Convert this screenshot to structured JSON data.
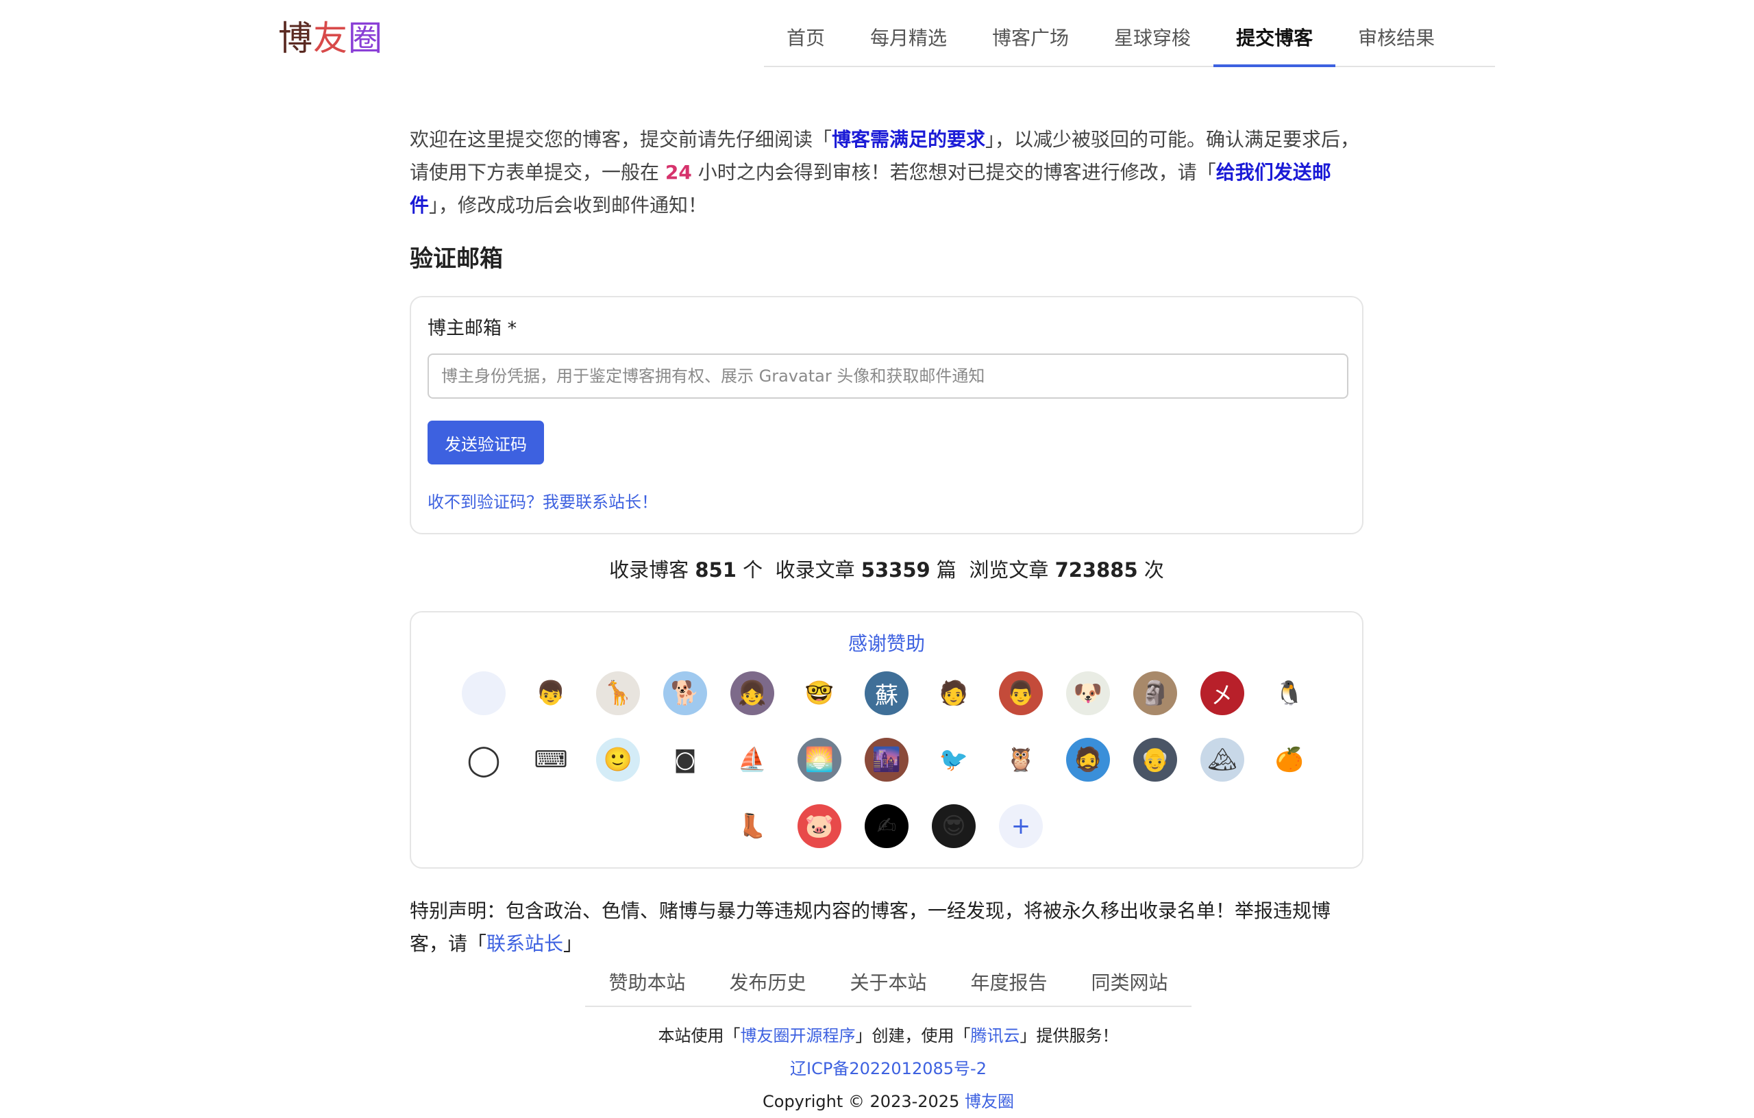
{
  "site": {
    "logo_chars": [
      "博",
      "友",
      "圈"
    ],
    "logo_colors": [
      "#5b2a22",
      "#d84a4a",
      "#8a3fd6"
    ]
  },
  "nav": {
    "items": [
      {
        "label": "首页"
      },
      {
        "label": "每月精选"
      },
      {
        "label": "博客广场"
      },
      {
        "label": "星球穿梭"
      },
      {
        "label": "提交博客",
        "active": true
      },
      {
        "label": "审核结果"
      }
    ]
  },
  "intro": {
    "t1": "欢迎在这里提交您的博客，提交前请先仔细阅读「",
    "link_requirements": "博客需满足的要求",
    "t2": "」，以减少被驳回的可能。确认满足要求后，请使用下方表单提交，一般在 ",
    "hours": "24",
    "t3": " 小时之内会得到审核！若您想对已提交的博客进行修改，请「",
    "link_email": "给我们发送邮件",
    "t4": "」，修改成功后会收到邮件通知！"
  },
  "verify": {
    "heading": "验证邮箱",
    "field_label": "博主邮箱 *",
    "email_placeholder": "博主身份凭据，用于鉴定博客拥有权、展示 Gravatar 头像和获取邮件通知",
    "email_value": "",
    "send_button": "发送验证码",
    "help_link": "收不到验证码？我要联系站长！"
  },
  "stats": {
    "blogs_prefix": "收录博客 ",
    "blogs_count": "851",
    "blogs_unit": " 个",
    "articles_prefix": "收录文章 ",
    "articles_count": "53359",
    "articles_unit": " 篇",
    "views_prefix": "浏览文章 ",
    "views_count": "723885",
    "views_unit": " 次"
  },
  "sponsors": {
    "title": "感谢赞助",
    "avatars": [
      {
        "icon": "blank-avatar",
        "glyph": "",
        "bg": "#edf1fb"
      },
      {
        "icon": "cartoon-boy-avatar",
        "glyph": "👦",
        "bg": "#ffffff"
      },
      {
        "icon": "giraffe-avatar",
        "glyph": "🦒",
        "bg": "#e8e4de"
      },
      {
        "icon": "corgi-avatar",
        "glyph": "🐕",
        "bg": "#9fc9ef"
      },
      {
        "icon": "anime-girl-avatar",
        "glyph": "👧",
        "bg": "#7d6a8a"
      },
      {
        "icon": "glasses-man-avatar",
        "glyph": "🤓",
        "bg": "#ffffff"
      },
      {
        "icon": "su-character-avatar",
        "glyph": "蘇",
        "bg": "#3f6f98"
      },
      {
        "icon": "pixel-boy-avatar",
        "glyph": "🧑",
        "bg": "#ffffff"
      },
      {
        "icon": "man-portrait-avatar",
        "glyph": "👨",
        "bg": "#c44b3a"
      },
      {
        "icon": "white-dog-avatar",
        "glyph": "🐶",
        "bg": "#e9ece4"
      },
      {
        "icon": "sculpture-avatar",
        "glyph": "🗿",
        "bg": "#a8896a"
      },
      {
        "icon": "red-logo-avatar",
        "glyph": "㐅",
        "bg": "#b8202a"
      },
      {
        "icon": "penguin-avatar",
        "glyph": "🐧",
        "bg": "#ffffff"
      },
      {
        "icon": "black-ring-avatar",
        "glyph": "◯",
        "bg": "#ffffff"
      },
      {
        "icon": "typewriter-avatar",
        "glyph": "⌨",
        "bg": "#ffffff"
      },
      {
        "icon": "smiling-boy-avatar",
        "glyph": "🙂",
        "bg": "#d4ecf7"
      },
      {
        "icon": "eye-box-avatar",
        "glyph": "◙",
        "bg": "#ffffff"
      },
      {
        "icon": "sailor-avatar",
        "glyph": "⛵",
        "bg": "#ffffff"
      },
      {
        "icon": "sunset-avatar",
        "glyph": "🌅",
        "bg": "#6f7f90"
      },
      {
        "icon": "couple-photo-avatar",
        "glyph": "🌆",
        "bg": "#8a4a3a"
      },
      {
        "icon": "bird-logo-avatar",
        "glyph": "🐦",
        "bg": "#ffffff"
      },
      {
        "icon": "owl-cat-avatar",
        "glyph": "🦉",
        "bg": "#ffffff"
      },
      {
        "icon": "blue-man-avatar",
        "glyph": "🧔",
        "bg": "#3a8fd9"
      },
      {
        "icon": "white-hair-avatar",
        "glyph": "👴",
        "bg": "#4a5566"
      },
      {
        "icon": "snow-mountain-avatar",
        "glyph": "🏔",
        "bg": "#c8d8e8"
      },
      {
        "icon": "orange-avatar",
        "glyph": "🍊",
        "bg": "#ffffff"
      },
      {
        "icon": "boot-avatar",
        "glyph": "👢",
        "bg": "#ffffff"
      },
      {
        "icon": "pink-pig-avatar",
        "glyph": "🐷",
        "bg": "#e84a4a"
      },
      {
        "icon": "signature-avatar",
        "glyph": "✍",
        "bg": "#000000"
      },
      {
        "icon": "sunglasses-avatar",
        "glyph": "😎",
        "bg": "#1a1a1a"
      },
      {
        "icon": "plus-icon",
        "glyph": "+",
        "bg": "#eef1fb",
        "plus": true
      }
    ]
  },
  "notice": {
    "text": "特别声明：包含政治、色情、赌博与暴力等违规内容的博客，一经发现，将被永久移出收录名单！举报违规博客，请「",
    "link": "联系站长",
    "tail": "」"
  },
  "footer": {
    "nav": [
      {
        "label": "赞助本站"
      },
      {
        "label": "发布历史"
      },
      {
        "label": "关于本站"
      },
      {
        "label": "年度报告"
      },
      {
        "label": "同类网站"
      }
    ],
    "line1_a": "本站使用「",
    "line1_link1": "博友圈开源程序",
    "line1_b": "」创建，使用「",
    "line1_link2": "腾讯云",
    "line1_c": "」提供服务！",
    "icp": "辽ICP备2022012085号-2",
    "copyright": "Copyright © 2023-2025 ",
    "copyright_link": "博友圈"
  }
}
